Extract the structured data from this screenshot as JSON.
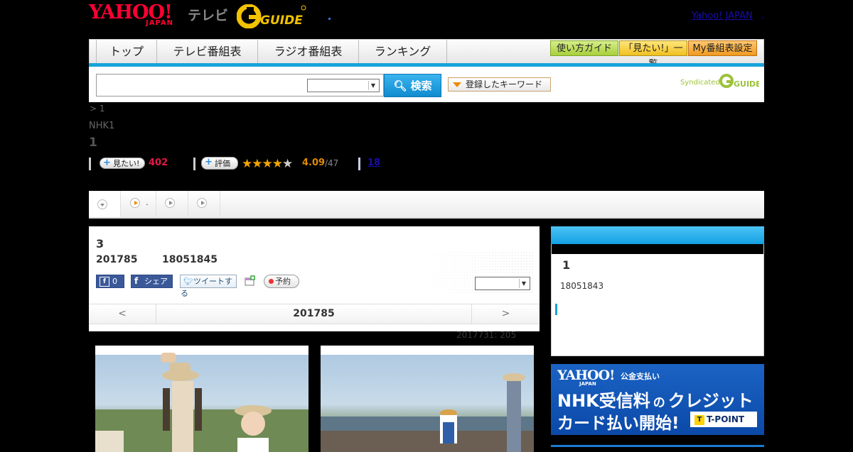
{
  "header": {
    "logo_yahoo": "YAHOO!",
    "logo_japan": "JAPAN",
    "logo_tv": "テレビ",
    "logo_gguide": "GUIDE",
    "link_yahoo": "Yahoo! JAPAN",
    "link_dot": "."
  },
  "nav": {
    "tabs": [
      "トップ",
      "テレビ番組表",
      "ラジオ番組表",
      "ランキング"
    ],
    "buttons": [
      "使い方ガイド",
      "「見たい!」一覧",
      "My番組表設定"
    ]
  },
  "search": {
    "button": "検索",
    "keyword_button": "登録したキーワード",
    "syndicated": "Syndicated",
    "gguide": "GUIDE"
  },
  "breadcrumb": "> 1",
  "channel": "NHK1",
  "title": "1",
  "stats": {
    "want_label": "見たい!",
    "want_count": "402",
    "rate_label": "評価",
    "rating": "4.09",
    "rating_count": "/47",
    "reviews": "18",
    "rating_value": 4.09
  },
  "strip": {
    "tab2_label": "."
  },
  "episode": {
    "number": "3",
    "date": "201785",
    "time": "18051845"
  },
  "social": {
    "fb_count": "0",
    "fb_share": "シェア",
    "tweet": "ツイートする",
    "reserve": "予約"
  },
  "pager": {
    "prev": "<",
    "current": "201785",
    "next": ">"
  },
  "updated": "2017731: 205",
  "sidebar": {
    "title": "1",
    "time": "18051843"
  },
  "banner": {
    "yahoo": "YAHOO!",
    "japan": "JAPAN",
    "service": "公金支払い",
    "line1": "NHK受信料",
    "no": "の",
    "line1b": "クレジット",
    "line2": "カード払い開始!",
    "tpoint": "T-POINT"
  },
  "colors": {
    "accent_blue": "#16a3d9",
    "yahoo_red": "#ff0033",
    "star": "#f3a400",
    "want_red": "#e0194a"
  }
}
